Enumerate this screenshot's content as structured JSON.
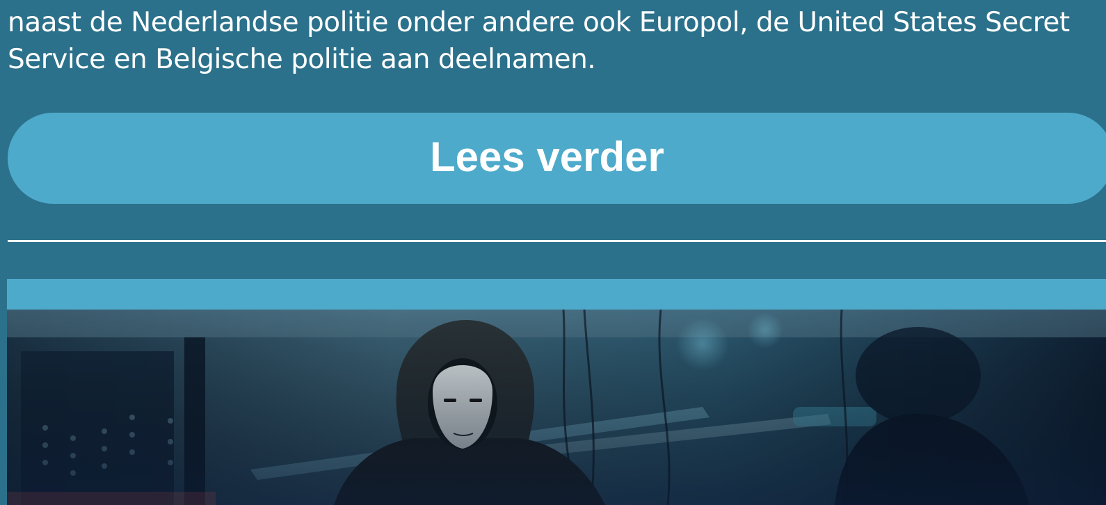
{
  "article": {
    "line1": "naast de Nederlandse politie onder andere ook Europol, de United States Secret",
    "line2": "Service en Belgische politie aan deelnamen."
  },
  "read_more": {
    "label": "Lees verder"
  },
  "colors": {
    "page_background": "#2c718b",
    "accent": "#4eaacb",
    "text": "#ffffff"
  },
  "hero_image": {
    "subject": "hooded figure with white mask in server room"
  }
}
